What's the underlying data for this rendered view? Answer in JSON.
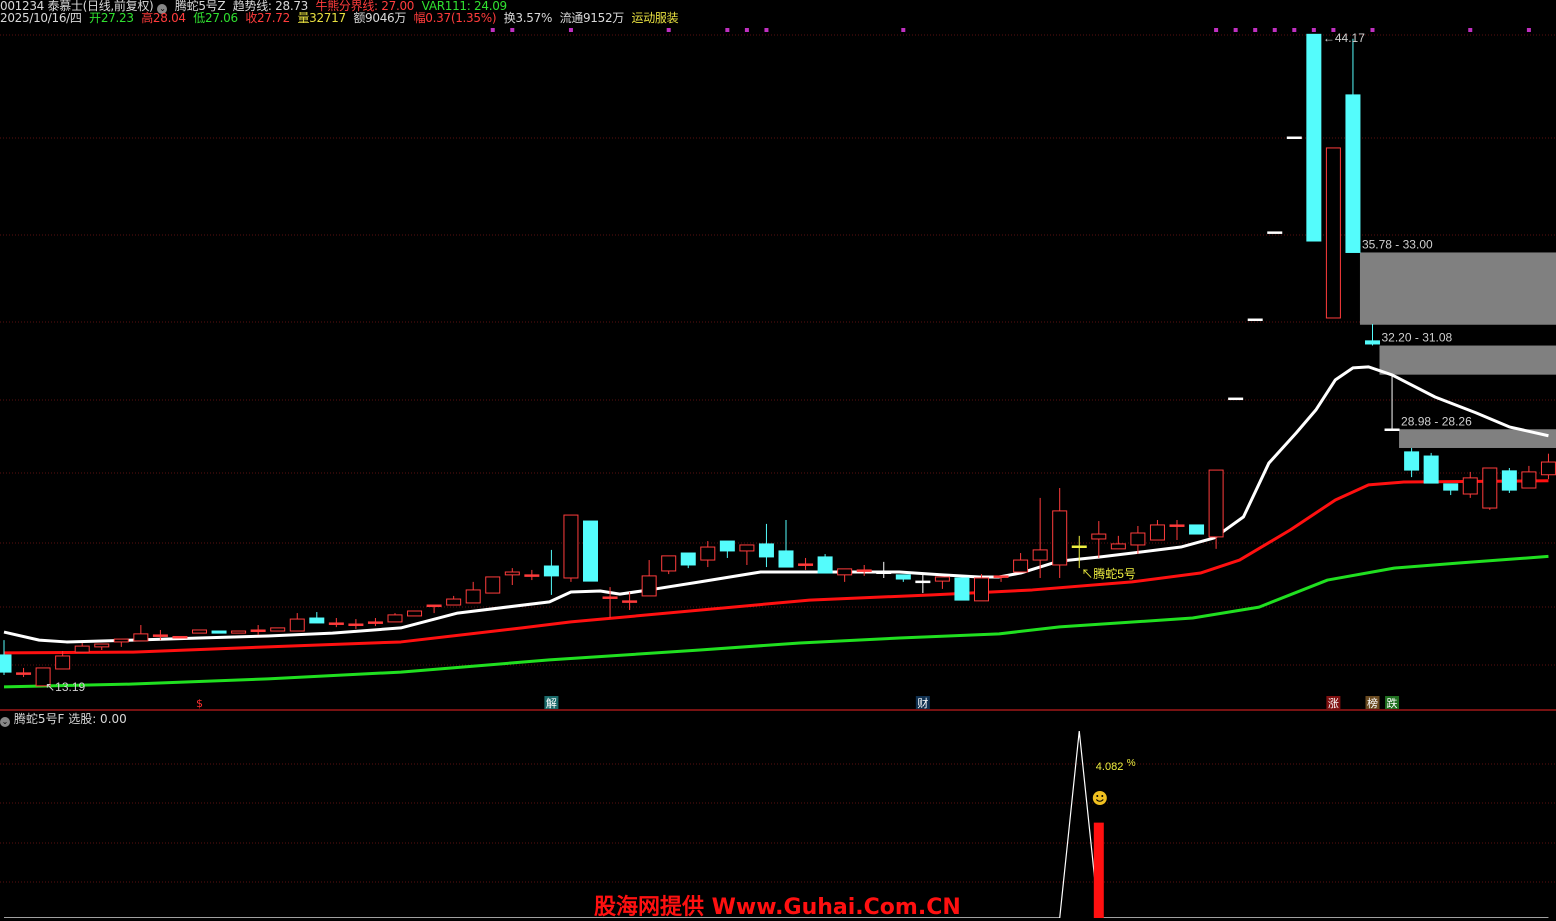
{
  "header": {
    "stock": "001234 泰慕士(日线,前复权)",
    "indicator_name": "腾蛇5号Z",
    "trend_line": "趋势线: 28.73",
    "bull_bear_line": "牛熊分界线: 27.00",
    "var111": "VAR111: 24.09",
    "date": "2025/10/16/四",
    "open": "开27.23",
    "high": "高28.04",
    "low": "低27.06",
    "close": "收27.72",
    "volume": "量32717",
    "amount": "额9046万",
    "change": "幅0.37(1.35%)",
    "turnover": "换3.57%",
    "float": "流通9152万",
    "sector": "运动服装"
  },
  "colors": {
    "up": "#ff3c3c",
    "down": "#54fcfc",
    "doji": "#ffffff",
    "signal": "#f0f040",
    "ma_trend": "#ffffff",
    "ma_bullbear": "#ff1010",
    "ma_var111": "#20e020",
    "gap": "#808080",
    "grid": "#5a1010",
    "marker": "#c030c0"
  },
  "chart_data": [
    {
      "type": "candlestick",
      "title": "001234 泰慕士 日线",
      "ylim": [
        10.2,
        45.49
      ],
      "candles_fields": [
        "open",
        "close",
        "high",
        "low",
        "style"
      ],
      "candles": [
        [
          20.3,
          19.64,
          20.87,
          19.53
        ],
        [
          19.61,
          19.61,
          19.8,
          19.45
        ],
        [
          19.11,
          19.8,
          19.8,
          19.11
        ],
        [
          19.76,
          20.26,
          20.45,
          19.76
        ],
        [
          20.41,
          20.64,
          20.76,
          20.41
        ],
        [
          20.61,
          20.72,
          20.72,
          20.49
        ],
        [
          20.8,
          20.91,
          20.91,
          20.61
        ],
        [
          20.84,
          21.11,
          21.45,
          20.84
        ],
        [
          21.07,
          21.07,
          21.26,
          20.87
        ],
        [
          20.99,
          21.01,
          21.01,
          20.99
        ],
        [
          21.14,
          21.26,
          21.26,
          21.14
        ],
        [
          21.22,
          21.14,
          21.22,
          21.14
        ],
        [
          21.14,
          21.22,
          21.22,
          21.14
        ],
        [
          21.26,
          21.26,
          21.45,
          21.07
        ],
        [
          21.22,
          21.34,
          21.34,
          21.22
        ],
        [
          21.22,
          21.68,
          21.91,
          21.22
        ],
        [
          21.72,
          21.53,
          21.95,
          21.53
        ],
        [
          21.53,
          21.53,
          21.72,
          21.37
        ],
        [
          21.49,
          21.49,
          21.68,
          21.3
        ],
        [
          21.57,
          21.57,
          21.72,
          21.41
        ],
        [
          21.57,
          21.84,
          21.91,
          21.57
        ],
        [
          21.8,
          21.99,
          21.99,
          21.8
        ],
        [
          22.2,
          22.22,
          22.22,
          21.91
        ],
        [
          22.22,
          22.45,
          22.57,
          22.22
        ],
        [
          22.3,
          22.8,
          23.11,
          22.3
        ],
        [
          22.68,
          23.3,
          23.3,
          22.68
        ],
        [
          23.38,
          23.49,
          23.64,
          22.99
        ],
        [
          23.38,
          23.38,
          23.57,
          23.18
        ],
        [
          23.72,
          23.34,
          24.34,
          22.61
        ],
        [
          23.26,
          25.68,
          25.68,
          23.11
        ],
        [
          25.45,
          23.14,
          25.45,
          23.14
        ],
        [
          22.53,
          22.53,
          22.91,
          21.72
        ],
        [
          22.38,
          22.38,
          22.72,
          22.03
        ],
        [
          22.57,
          23.34,
          23.95,
          22.57
        ],
        [
          23.53,
          24.11,
          24.11,
          23.41
        ],
        [
          24.22,
          23.76,
          24.22,
          23.64
        ],
        [
          23.95,
          24.45,
          24.68,
          23.68
        ],
        [
          24.68,
          24.3,
          24.68,
          24.03
        ],
        [
          24.3,
          24.53,
          24.53,
          23.76
        ],
        [
          24.57,
          24.07,
          25.34,
          23.68
        ],
        [
          24.3,
          23.68,
          25.49,
          23.68
        ],
        [
          23.8,
          23.8,
          24.03,
          23.57
        ],
        [
          24.07,
          23.45,
          24.18,
          23.45
        ],
        [
          23.38,
          23.61,
          23.61,
          23.11
        ],
        [
          23.57,
          23.57,
          23.76,
          23.34
        ],
        [
          23.49,
          23.49,
          23.88,
          23.26,
          "w"
        ],
        [
          23.38,
          23.22,
          23.38,
          23.11
        ],
        [
          23.14,
          23.14,
          23.45,
          22.68,
          "w"
        ],
        [
          23.14,
          23.3,
          23.3,
          22.84
        ],
        [
          23.26,
          22.41,
          23.26,
          22.41
        ],
        [
          22.38,
          23.26,
          23.41,
          22.38
        ],
        [
          23.32,
          23.34,
          23.34,
          23.11
        ],
        [
          23.49,
          23.95,
          24.22,
          23.49
        ],
        [
          23.95,
          24.34,
          26.34,
          23.26
        ],
        [
          23.76,
          25.84,
          26.72,
          23.26
        ],
        [
          24.49,
          24.49,
          24.88,
          23.64,
          "y"
        ],
        [
          24.76,
          24.95,
          25.45,
          24.03
        ],
        [
          24.38,
          24.57,
          24.88,
          24.38
        ],
        [
          24.53,
          24.99,
          25.26,
          24.18
        ],
        [
          24.72,
          25.3,
          25.49,
          24.72
        ],
        [
          25.28,
          25.3,
          25.49,
          24.72
        ],
        [
          25.3,
          24.95,
          25.3,
          24.95
        ],
        [
          24.84,
          27.41,
          27.41,
          24.38
        ],
        [
          30.18,
          30.18,
          30.18,
          30.18,
          "w"
        ],
        [
          33.22,
          33.22,
          33.22,
          33.22,
          "w"
        ],
        [
          36.57,
          36.57,
          36.57,
          36.57,
          "w"
        ],
        [
          40.22,
          40.22,
          40.22,
          40.22,
          "w"
        ],
        [
          44.17,
          36.22,
          44.17,
          36.22
        ],
        [
          33.26,
          39.8,
          39.8,
          33.26
        ],
        [
          41.84,
          35.78,
          44.0,
          35.78
        ],
        [
          32.38,
          32.26,
          33.03,
          32.2
        ],
        [
          28.98,
          28.99,
          31.08,
          28.98,
          "w"
        ],
        [
          28.11,
          27.41,
          28.26,
          27.14
        ],
        [
          27.95,
          26.91,
          28.07,
          26.91
        ],
        [
          26.88,
          26.64,
          26.88,
          26.45
        ],
        [
          26.49,
          27.11,
          27.34,
          26.34
        ],
        [
          25.95,
          27.49,
          27.49,
          25.88
        ],
        [
          27.38,
          26.64,
          27.49,
          26.53
        ],
        [
          26.72,
          27.34,
          27.57,
          26.72
        ],
        [
          27.23,
          27.72,
          28.04,
          27.06
        ]
      ],
      "series": [
        {
          "name": "趋势线",
          "color_key": "ma_trend",
          "points": [
            [
              0,
              21.18
            ],
            [
              1.8,
              20.87
            ],
            [
              3.2,
              20.8
            ],
            [
              6.6,
              20.87
            ],
            [
              10,
              20.95
            ],
            [
              13.5,
              21.03
            ],
            [
              16.8,
              21.14
            ],
            [
              20.3,
              21.34
            ],
            [
              23.2,
              21.91
            ],
            [
              27.9,
              22.34
            ],
            [
              29,
              22.72
            ],
            [
              30.5,
              22.76
            ],
            [
              31.5,
              22.64
            ],
            [
              33,
              22.8
            ],
            [
              35.6,
              23.11
            ],
            [
              38.7,
              23.49
            ],
            [
              40.7,
              23.49
            ],
            [
              45.8,
              23.49
            ],
            [
              48,
              23.38
            ],
            [
              49.9,
              23.3
            ],
            [
              50.9,
              23.3
            ],
            [
              52,
              23.45
            ],
            [
              53.5,
              23.8
            ],
            [
              54,
              23.91
            ],
            [
              56.1,
              24.07
            ],
            [
              60.2,
              24.45
            ],
            [
              61.9,
              24.8
            ],
            [
              63.4,
              25.61
            ],
            [
              64.7,
              27.68
            ],
            [
              66.1,
              28.84
            ],
            [
              67.1,
              29.72
            ],
            [
              68.1,
              30.88
            ],
            [
              69,
              31.34
            ],
            [
              69.8,
              31.38
            ],
            [
              71,
              31.07
            ],
            [
              73.2,
              30.22
            ],
            [
              75.3,
              29.61
            ],
            [
              77,
              29.07
            ],
            [
              79,
              28.73
            ]
          ]
        },
        {
          "name": "牛熊分界线",
          "color_key": "ma_bullbear",
          "points": [
            [
              0,
              20.38
            ],
            [
              6.6,
              20.41
            ],
            [
              13.5,
              20.61
            ],
            [
              20.3,
              20.8
            ],
            [
              26.5,
              21.34
            ],
            [
              29,
              21.57
            ],
            [
              41.2,
              22.41
            ],
            [
              47.5,
              22.61
            ],
            [
              52.6,
              22.8
            ],
            [
              57.7,
              23.11
            ],
            [
              61.2,
              23.45
            ],
            [
              63.2,
              23.95
            ],
            [
              65.8,
              25.11
            ],
            [
              68.1,
              26.26
            ],
            [
              69.8,
              26.84
            ],
            [
              71.6,
              26.95
            ],
            [
              79,
              27.0
            ]
          ]
        },
        {
          "name": "VAR111",
          "color_key": "ma_var111",
          "points": [
            [
              0,
              19.07
            ],
            [
              6.6,
              19.18
            ],
            [
              13.5,
              19.38
            ],
            [
              20.3,
              19.64
            ],
            [
              27.9,
              20.11
            ],
            [
              35.6,
              20.49
            ],
            [
              40.7,
              20.76
            ],
            [
              45.8,
              20.95
            ],
            [
              50.9,
              21.11
            ],
            [
              54,
              21.38
            ],
            [
              60.8,
              21.72
            ],
            [
              64.2,
              22.14
            ],
            [
              67.7,
              23.18
            ],
            [
              71.1,
              23.64
            ],
            [
              74.5,
              23.84
            ],
            [
              79,
              24.09
            ]
          ]
        }
      ],
      "gaps": [
        {
          "from_index": 69,
          "top": 35.78,
          "bottom": 33.0,
          "label": "35.78 - 33.00"
        },
        {
          "from_index": 70,
          "top": 32.2,
          "bottom": 31.08,
          "label": "32.20 - 31.08"
        },
        {
          "from_index": 71,
          "top": 28.98,
          "bottom": 28.26,
          "label": "28.98 - 28.26"
        }
      ],
      "annotations": [
        {
          "index": 67,
          "price": 44.17,
          "label": "44.17",
          "arrow": "←",
          "kind": "high"
        },
        {
          "index": 2,
          "price": 18.6,
          "label": "13.19",
          "arrow": "↖",
          "kind": "low"
        },
        {
          "index": 55,
          "price": 22.4,
          "label": "腾蛇5号",
          "arrow": "↖",
          "kind": "signal"
        }
      ],
      "top_markers": [
        25,
        26,
        29,
        34,
        37,
        38,
        39,
        46,
        62,
        63,
        64,
        65,
        66,
        67,
        68,
        70,
        75,
        78
      ],
      "events": [
        {
          "index": 10,
          "label": "$",
          "bg": "#000000",
          "fg": "#ff3030"
        },
        {
          "index": 28,
          "label": "解",
          "bg": "#1a6a6a",
          "fg": "#ffffff"
        },
        {
          "index": 47,
          "label": "财",
          "bg": "#103050",
          "fg": "#ffffff"
        },
        {
          "index": 68,
          "label": "涨",
          "bg": "#801010",
          "fg": "#ffffff"
        },
        {
          "index": 70,
          "label": "榜",
          "bg": "#6a4a20",
          "fg": "#ffffff"
        },
        {
          "index": 71,
          "label": "跌",
          "bg": "#207020",
          "fg": "#ffffff"
        }
      ]
    },
    {
      "type": "indicator",
      "title": "腾蛇5号F",
      "ylim": [
        0,
        1
      ],
      "signal_line": {
        "name": "选股",
        "points": [
          [
            0,
            0
          ],
          [
            54,
            0
          ],
          [
            55,
            1
          ],
          [
            56,
            0
          ],
          [
            79,
            0
          ]
        ]
      },
      "bars": [
        {
          "index": 56,
          "value": 0.51
        }
      ],
      "signal_label": {
        "index": 56,
        "value": "4.082",
        "unit": "%"
      },
      "smiley_index": 56
    }
  ],
  "indicator_panel": {
    "name": "腾蛇5号F",
    "select_label": "选股: 0.00"
  },
  "watermark": "股海网提供 Www.Guhai.Com.CN"
}
